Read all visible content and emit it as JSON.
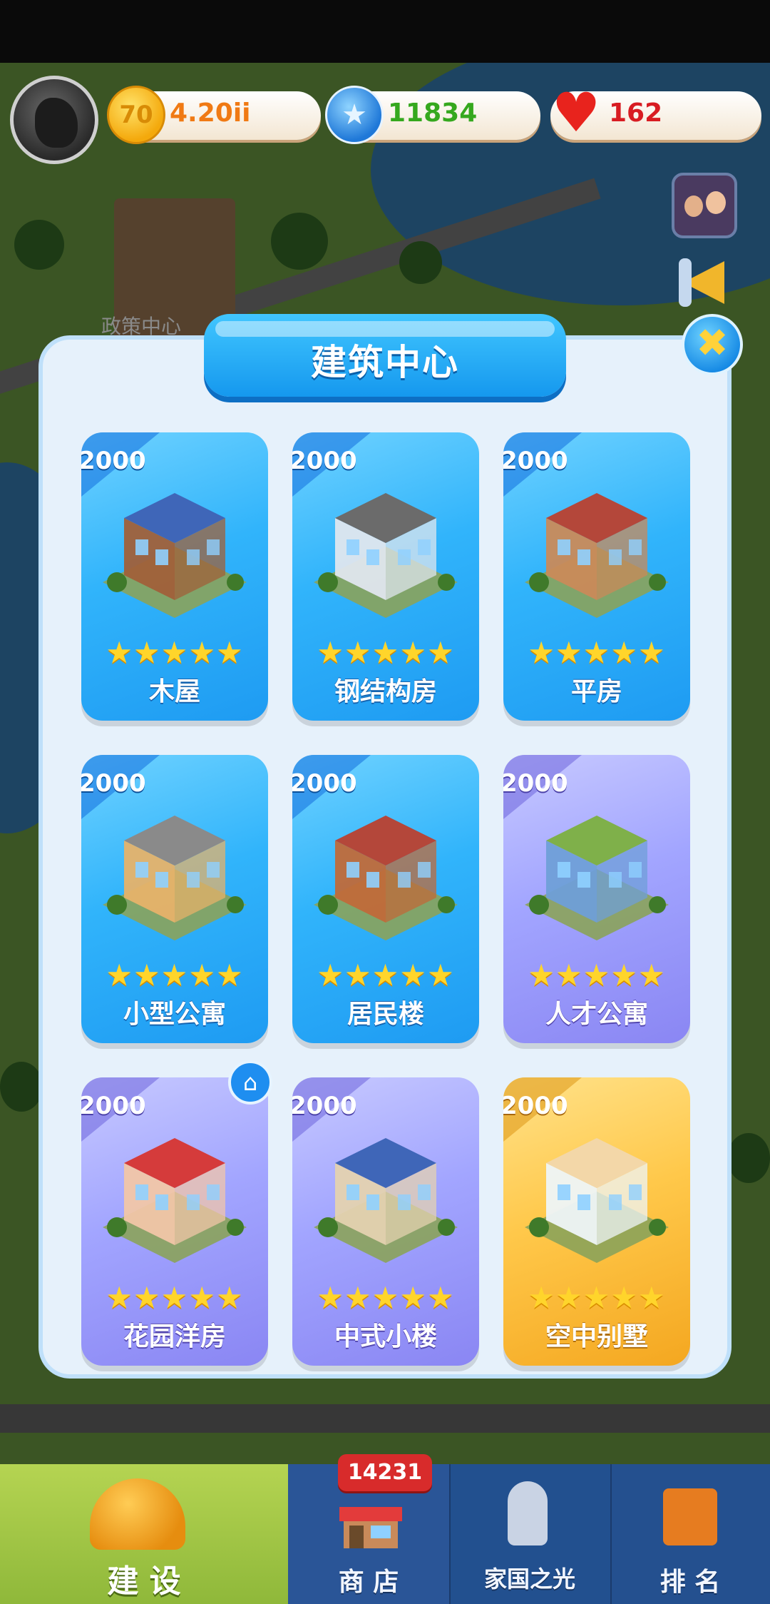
{
  "hud": {
    "coins": "4.20ii",
    "gems": "11834",
    "hearts": "162",
    "coin_icon_glyph": "70",
    "gem_icon_glyph": "★",
    "heart_icon_glyph": "♥"
  },
  "map": {
    "label": "政策中心"
  },
  "dialog": {
    "title": "建筑中心",
    "close_glyph": "✖",
    "buildings": [
      {
        "name": "木屋",
        "price": "2000",
        "stars": "★★★★★",
        "theme": "blue"
      },
      {
        "name": "钢结构房",
        "price": "2000",
        "stars": "★★★★★",
        "theme": "blue"
      },
      {
        "name": "平房",
        "price": "2000",
        "stars": "★★★★★",
        "theme": "blue"
      },
      {
        "name": "小型公寓",
        "price": "2000",
        "stars": "★★★★★",
        "theme": "blue"
      },
      {
        "name": "居民楼",
        "price": "2000",
        "stars": "★★★★★",
        "theme": "blue"
      },
      {
        "name": "人才公寓",
        "price": "2000",
        "stars": "★★★★★",
        "theme": "purple"
      },
      {
        "name": "花园洋房",
        "price": "2000",
        "stars": "★★★★★",
        "theme": "purple"
      },
      {
        "name": "中式小楼",
        "price": "2000",
        "stars": "★★★★★",
        "theme": "purple"
      },
      {
        "name": "空中别墅",
        "price": "2000",
        "stars": "★★★★★",
        "theme": "gold"
      }
    ],
    "home_badge_glyph": "⌂"
  },
  "nav": {
    "build": "建 设",
    "shop": "商 店",
    "shop_badge": "14231",
    "nation": "家国之光",
    "rank": "排 名"
  },
  "colors": {
    "card_blue": "#31b4fb",
    "card_purple": "#a2a5ff",
    "card_gold": "#ffc84a",
    "coin_text": "#f07a14",
    "gem_text": "#35a81e",
    "heart_text": "#d81c22"
  }
}
